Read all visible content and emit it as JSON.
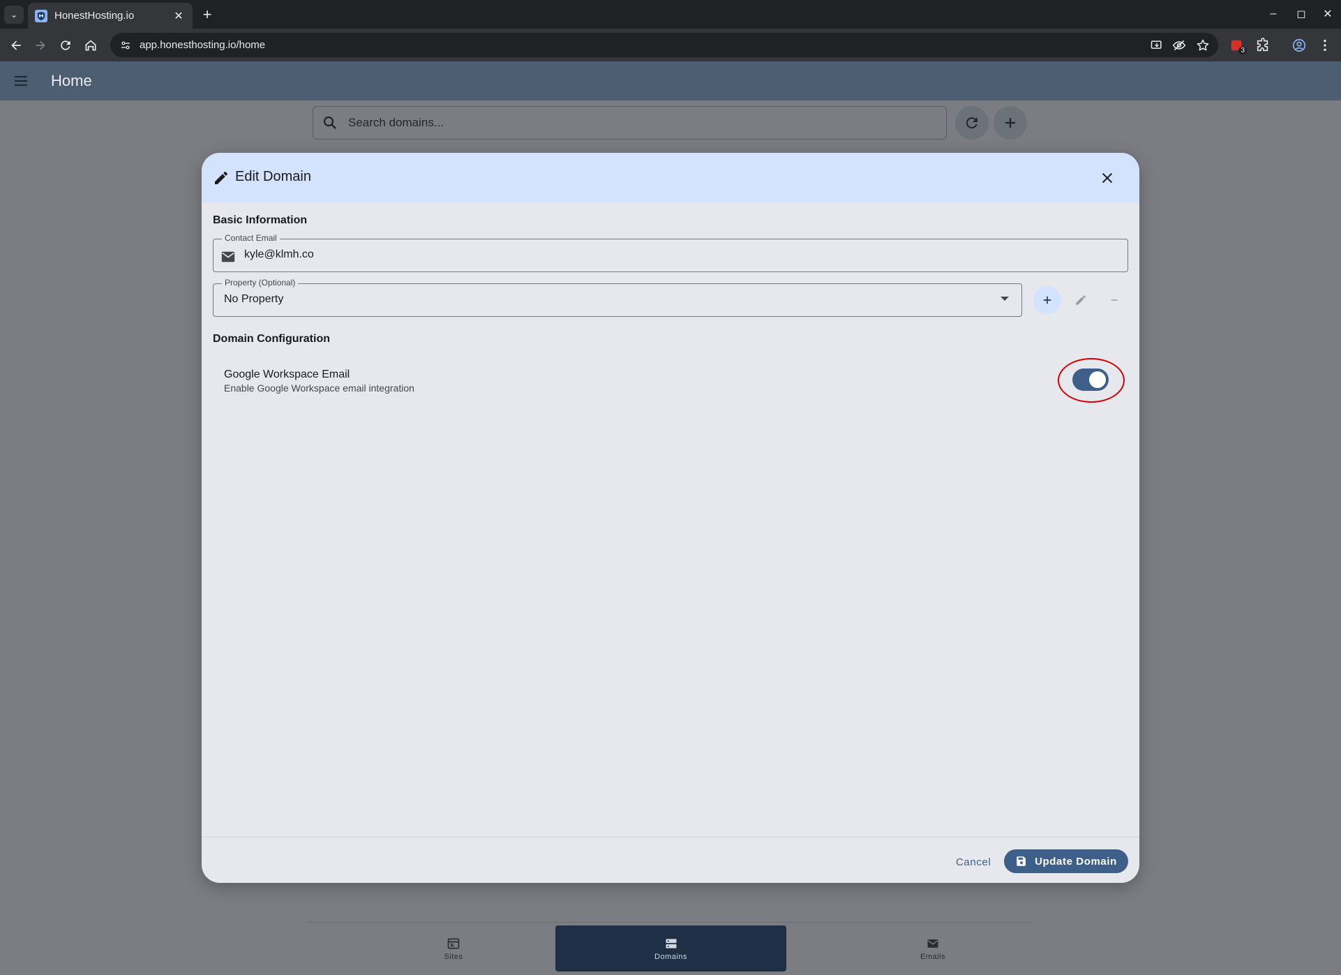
{
  "browser": {
    "tab_title": "HonestHosting.io",
    "url": "app.honesthosting.io/home",
    "extension_badge": "3"
  },
  "app": {
    "title": "Home",
    "search_placeholder": "Search domains..."
  },
  "dialog": {
    "title": "Edit Domain",
    "basic_section": "Basic Information",
    "contact_email_label": "Contact Email",
    "contact_email_value": "kyle@klmh.co",
    "property_label": "Property (Optional)",
    "property_value": "No Property",
    "config_section": "Domain Configuration",
    "google_workspace_label": "Google Workspace Email",
    "google_workspace_desc": "Enable Google Workspace email integration",
    "google_workspace_enabled": true,
    "cancel_label": "Cancel",
    "update_label": "Update Domain"
  },
  "bottom_nav": {
    "items": [
      {
        "label": "Sites",
        "icon": "calendar-card-icon"
      },
      {
        "label": "Domains",
        "icon": "storage-icon",
        "active": true
      },
      {
        "label": "Emails",
        "icon": "mail-icon"
      }
    ]
  },
  "colors": {
    "primary": "#3d5f8a",
    "dialog_header": "#d3e3fd",
    "appbar": "#4d5e73",
    "highlight": "#d40000"
  }
}
